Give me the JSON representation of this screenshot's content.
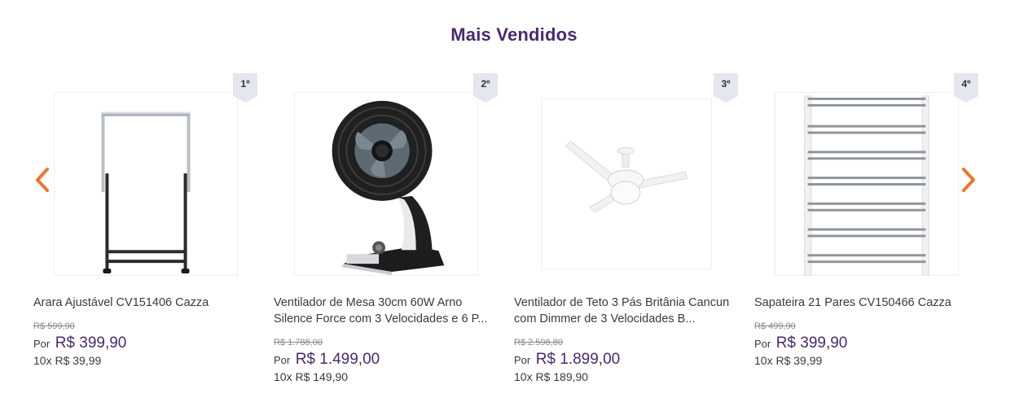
{
  "section": {
    "title": "Mais Vendidos"
  },
  "colors": {
    "title": "#4a2a6b",
    "arrow": "#e8782f",
    "price": "#4a2a6b",
    "rank_badge": "#e4e7ef"
  },
  "nav": {
    "prev_icon": "chevron-left-icon",
    "next_icon": "chevron-right-icon"
  },
  "products": [
    {
      "rank": "1º",
      "name": "Arara Ajustável CV151406 Cazza",
      "old_price": "R$ 599,90",
      "por_label": "Por",
      "price": "R$ 399,90",
      "installments": "10x R$ 39,99",
      "image": "clothes-rack"
    },
    {
      "rank": "2º",
      "name": "Ventilador de Mesa 30cm 60W Arno Silence Force com 3 Velocidades e 6 P...",
      "old_price": "R$ 1.788,00",
      "por_label": "Por",
      "price": "R$ 1.499,00",
      "installments": "10x R$ 149,90",
      "image": "table-fan"
    },
    {
      "rank": "3º",
      "name": "Ventilador de Teto 3 Pás Britânia Cancun com Dimmer de 3 Velocidades B...",
      "old_price": "R$ 2.598,80",
      "por_label": "Por",
      "price": "R$ 1.899,00",
      "installments": "10x R$ 189,90",
      "image": "ceiling-fan"
    },
    {
      "rank": "4º",
      "name": "Sapateira 21 Pares CV150466 Cazza",
      "old_price": "R$ 499,90",
      "por_label": "Por",
      "price": "R$ 399,90",
      "installments": "10x R$ 39,99",
      "image": "shoe-rack"
    }
  ]
}
